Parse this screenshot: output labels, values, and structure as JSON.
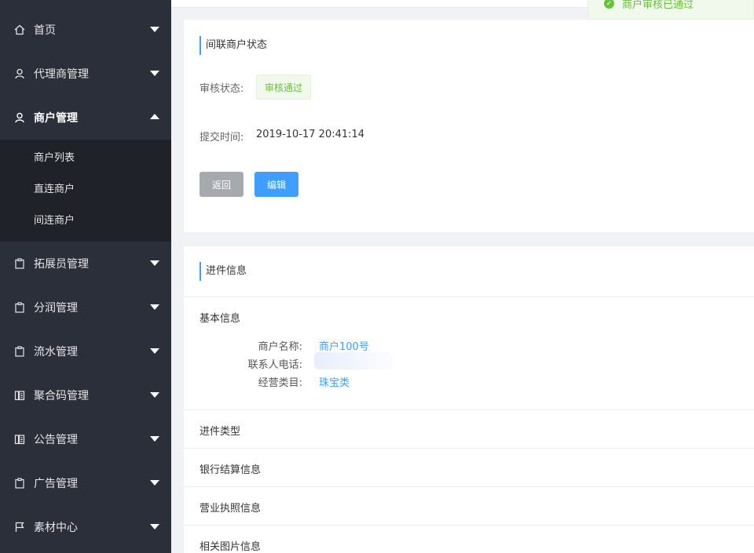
{
  "sidebar": {
    "items": [
      {
        "label": "首页",
        "icon": "home-icon"
      },
      {
        "label": "代理商管理",
        "icon": "user-icon"
      },
      {
        "label": "商户管理",
        "icon": "user-icon",
        "expanded": true
      },
      {
        "label": "拓展员管理",
        "icon": "clipboard-icon"
      },
      {
        "label": "分润管理",
        "icon": "clipboard-icon"
      },
      {
        "label": "流水管理",
        "icon": "clipboard-icon"
      },
      {
        "label": "聚合码管理",
        "icon": "book-icon"
      },
      {
        "label": "公告管理",
        "icon": "book-icon"
      },
      {
        "label": "广告管理",
        "icon": "clipboard-icon"
      },
      {
        "label": "素材中心",
        "icon": "flag-icon"
      }
    ],
    "submenu": [
      "商户列表",
      "直连商户",
      "间连商户"
    ]
  },
  "toast": {
    "text": "商户审核已通过",
    "color": "#67c23a"
  },
  "status_card": {
    "title": "间联商户状态",
    "audit_label": "审核状态:",
    "audit_value": "审核通过",
    "submit_label": "提交时间:",
    "submit_value": "2019-10-17 20:41:14",
    "back_button": "返回",
    "edit_button": "编辑"
  },
  "info_card": {
    "title": "进件信息",
    "basic_heading": "基本信息",
    "fields": [
      {
        "label": "商户名称:",
        "value": "商户100号"
      },
      {
        "label": "联系人电话:",
        "value": ""
      },
      {
        "label": "经营类目:",
        "value": "珠宝类"
      }
    ],
    "sections": [
      "进件类型",
      "银行结算信息",
      "营业执照信息",
      "相关图片信息"
    ]
  },
  "colors": {
    "sidebar_bg": "#2b2f3a",
    "submenu_bg": "#1f2229",
    "accent": "#409eff",
    "success": "#67c23a"
  }
}
